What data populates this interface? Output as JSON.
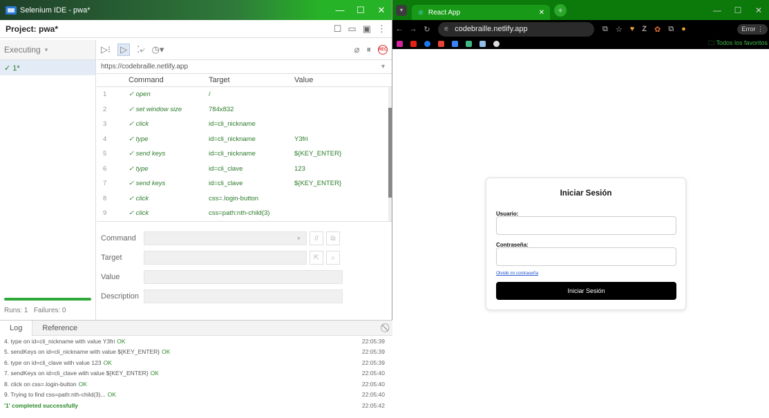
{
  "ide": {
    "window_title": "Selenium IDE - pwa*",
    "project_label": "Project:  pwa*",
    "executing_label": "Executing",
    "suite_item": "✓ 1*",
    "runs": "Runs: 1",
    "failures": "Failures: 0",
    "progress": 1.0,
    "base_url": "https://codebraille.netlify.app",
    "columns": {
      "command": "Command",
      "target": "Target",
      "value": "Value"
    },
    "commands": [
      {
        "n": "1",
        "cmd": "✓ open",
        "target": "/",
        "value": ""
      },
      {
        "n": "2",
        "cmd": "✓ set window size",
        "target": "784x832",
        "value": ""
      },
      {
        "n": "3",
        "cmd": "✓ click",
        "target": "id=cli_nickname",
        "value": ""
      },
      {
        "n": "4",
        "cmd": "✓ type",
        "target": "id=cli_nickname",
        "value": "Y3fri"
      },
      {
        "n": "5",
        "cmd": "✓ send keys",
        "target": "id=cli_nickname",
        "value": "${KEY_ENTER}"
      },
      {
        "n": "6",
        "cmd": "✓ type",
        "target": "id=cli_clave",
        "value": "123"
      },
      {
        "n": "7",
        "cmd": "✓ send keys",
        "target": "id=cli_clave",
        "value": "${KEY_ENTER}"
      },
      {
        "n": "8",
        "cmd": "✓ click",
        "target": "css=.login-button",
        "value": ""
      },
      {
        "n": "9",
        "cmd": "✓ click",
        "target": "css=path:nth-child(3)",
        "value": ""
      }
    ],
    "editor": {
      "command": "Command",
      "target": "Target",
      "value": "Value",
      "description": "Description"
    },
    "log_tabs": {
      "log": "Log",
      "reference": "Reference"
    },
    "log": [
      {
        "text": "4.  type on id=cli_nickname with value Y3fri",
        "ok": "OK",
        "time": "22:05:39"
      },
      {
        "text": "5.  sendKeys on id=cli_nickname with value ${KEY_ENTER}",
        "ok": "OK",
        "time": "22:05:39"
      },
      {
        "text": "6.  type on id=cli_clave with value 123",
        "ok": "OK",
        "time": "22:05:39"
      },
      {
        "text": "7.  sendKeys on id=cli_clave with value ${KEY_ENTER}",
        "ok": "OK",
        "time": "22:05:40"
      },
      {
        "text": "8.  click on css=.login-button",
        "ok": "OK",
        "time": "22:05:40"
      },
      {
        "text": "9.  Trying to find css=path:nth-child(3)...",
        "ok": "OK",
        "time": "22:05:40"
      }
    ],
    "completed": {
      "text": "'1' completed successfully",
      "time": "22:05:42"
    }
  },
  "browser": {
    "tab_title": "React App",
    "address": "codebraille.netlify.app",
    "error_label": "Error",
    "bookmarks_folder": "Todos los favoritos",
    "login": {
      "title": "Iniciar Sesión",
      "user_label": "Usuario:",
      "pass_label": "Contraseña:",
      "forgot": "Olvidé mi contraseña",
      "button": "Iniciar Sesión"
    }
  },
  "colors": {
    "accent_green": "#2b7a2b",
    "titlebar_green": "#27b327",
    "progress": "#2ea836"
  }
}
